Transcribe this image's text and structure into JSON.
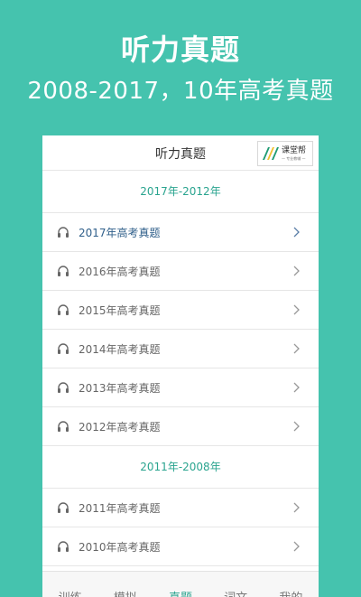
{
  "hero": {
    "title": "听力真题",
    "subtitle": "2008-2017，10年高考真题"
  },
  "app": {
    "title": "听力真题",
    "brand": {
      "name": "课堂帮",
      "tagline": "一 专业教辅 一"
    }
  },
  "sections": [
    {
      "title": "2017年-2012年",
      "items": [
        {
          "label": "2017年高考真题",
          "active": true
        },
        {
          "label": "2016年高考真题",
          "active": false
        },
        {
          "label": "2015年高考真题",
          "active": false
        },
        {
          "label": "2014年高考真题",
          "active": false
        },
        {
          "label": "2013年高考真题",
          "active": false
        },
        {
          "label": "2012年高考真题",
          "active": false
        }
      ]
    },
    {
      "title": "2011年-2008年",
      "items": [
        {
          "label": "2011年高考真题",
          "active": false
        },
        {
          "label": "2010年高考真题",
          "active": false
        }
      ]
    }
  ],
  "tabs": [
    {
      "label": "训练",
      "active": false
    },
    {
      "label": "模拟",
      "active": false
    },
    {
      "label": "真题",
      "active": true
    },
    {
      "label": "词文",
      "active": false
    },
    {
      "label": "我的",
      "active": false
    }
  ],
  "colors": {
    "background": "#45c3ae",
    "accent": "#2aa48f",
    "active_item": "#2f5f8a"
  },
  "icons": {
    "row_icon": "headphones-icon",
    "row_chevron": "chevron-right-icon"
  }
}
